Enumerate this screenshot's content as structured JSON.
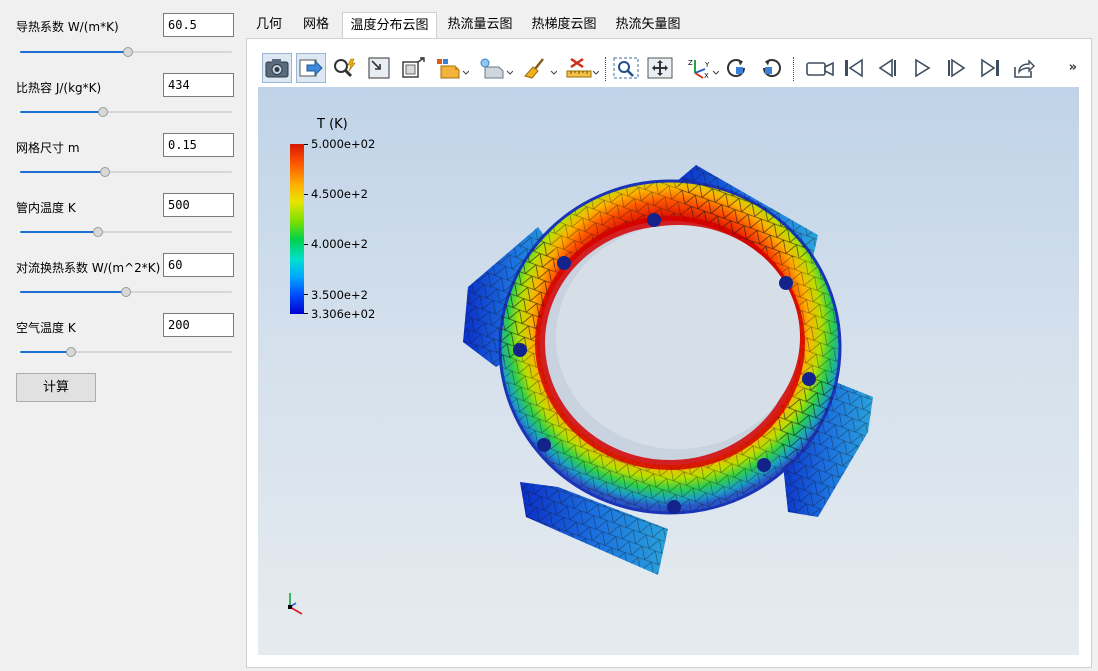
{
  "params": [
    {
      "label": "导热系数 W/(m*K)",
      "value": "60.5",
      "slider_fraction": 0.51
    },
    {
      "label": "比热容 J/(kg*K)",
      "value": "434",
      "slider_fraction": 0.39
    },
    {
      "label": "网格尺寸 m",
      "value": "0.15",
      "slider_fraction": 0.4
    },
    {
      "label": "管内温度 K",
      "value": "500",
      "slider_fraction": 0.37
    },
    {
      "label": "对流换热系数 W/(m^2*K)",
      "value": "60",
      "slider_fraction": 0.5
    },
    {
      "label": "空气温度 K",
      "value": "200",
      "slider_fraction": 0.24
    }
  ],
  "calc_button": "计算",
  "tabs": [
    {
      "label": "几何",
      "active": false
    },
    {
      "label": "网格",
      "active": false
    },
    {
      "label": "温度分布云图",
      "active": true
    },
    {
      "label": "热流量云图",
      "active": false
    },
    {
      "label": "热梯度云图",
      "active": false
    },
    {
      "label": "热流矢量图",
      "active": false
    }
  ],
  "toolbar": {
    "icons": [
      "camera-icon",
      "export-icon",
      "probe-icon",
      "fit-view-icon",
      "frame-icon",
      "box-select-icon",
      "display-mode-icon",
      "clear-brush-icon",
      "ruler-icon",
      "zoom-box-icon",
      "pan-icon",
      "axes-icon",
      "rotate-cw-icon",
      "rotate-ccw-icon",
      "video-camera-icon",
      "first-frame-icon",
      "prev-frame-icon",
      "play-icon",
      "next-frame-icon",
      "last-frame-icon",
      "share-icon"
    ],
    "more": "»"
  },
  "legend": {
    "title": "T (K)",
    "labels": [
      "5.000e+02",
      "4.500e+2",
      "4.000e+2",
      "3.500e+2",
      "3.306e+02"
    ],
    "min": 330.6,
    "max": 500,
    "values": [
      500,
      450,
      400,
      350,
      330.6
    ]
  },
  "colors": {
    "accent": "#1c6fd1",
    "hot": "#d11a00",
    "cold": "#0a22c8"
  }
}
